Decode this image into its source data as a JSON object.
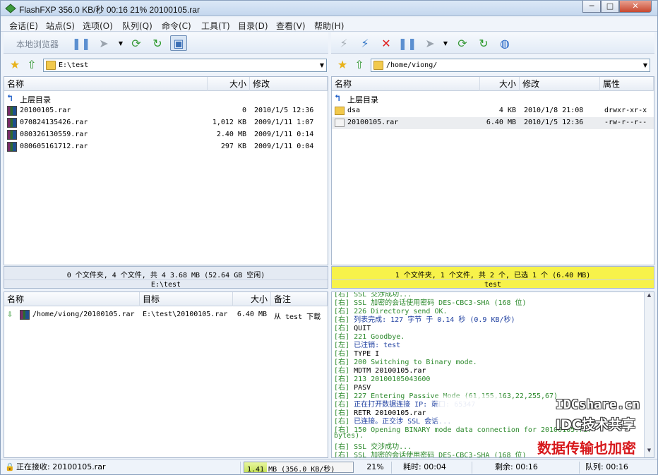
{
  "titlebar": {
    "title": "FlashFXP 356.0 KB/秒 00:16 21% 20100105.rar",
    "min": "─",
    "max": "□",
    "close": "✕"
  },
  "menu": [
    "会话(E)",
    "站点(S)",
    "选项(O)",
    "队列(Q)",
    "命令(C)",
    "工具(T)",
    "目录(D)",
    "查看(V)",
    "帮助(H)"
  ],
  "left_toolbar": {
    "browser_label": "本地浏览器"
  },
  "left_path": "E:\\test",
  "right_path": "/home/viong/",
  "left_columns": {
    "name": "名称",
    "size": "大小",
    "modified": "修改"
  },
  "right_columns": {
    "name": "名称",
    "size": "大小",
    "modified": "修改",
    "attr": "属性"
  },
  "left_files": [
    {
      "name": "上层目录",
      "size": "",
      "modified": "",
      "type": "up"
    },
    {
      "name": "20100105.rar",
      "size": "0",
      "modified": "2010/1/5 12:36",
      "type": "rar"
    },
    {
      "name": "070824135426.rar",
      "size": "1,012 KB",
      "modified": "2009/1/11 1:07",
      "type": "rar"
    },
    {
      "name": "080326130559.rar",
      "size": "2.40 MB",
      "modified": "2009/1/11 0:14",
      "type": "rar"
    },
    {
      "name": "080605161712.rar",
      "size": "297 KB",
      "modified": "2009/1/11 0:04",
      "type": "rar"
    }
  ],
  "right_files": [
    {
      "name": "上层目录",
      "size": "",
      "modified": "",
      "attr": "",
      "type": "up"
    },
    {
      "name": "dsa",
      "size": "4 KB",
      "modified": "2010/1/8 21:08",
      "attr": "drwxr-xr-x",
      "type": "folder"
    },
    {
      "name": "20100105.rar",
      "size": "6.40 MB",
      "modified": "2010/1/5 12:36",
      "attr": "-rw-r--r--",
      "type": "file"
    }
  ],
  "left_status": {
    "summary": "0 个文件夹, 4 个文件, 共 4 3.68 MB (52.64 GB 空闲)",
    "path": "E:\\test"
  },
  "right_status": {
    "summary": "1 个文件夹, 1 个文件, 共 2 个, 已选 1 个 (6.40 MB)",
    "path": "test"
  },
  "queue_columns": {
    "name": "名称",
    "target": "目标",
    "size": "大小",
    "note": "备注"
  },
  "queue": [
    {
      "name": "/home/viong/20100105.rar",
      "target": "E:\\test\\20100105.rar",
      "size": "6.40 MB",
      "note": "从 test 下载"
    }
  ],
  "log": [
    {
      "tag": "[右]",
      "text": "SSL 交涉成功...",
      "color": "#2d8a2d"
    },
    {
      "tag": "[右]",
      "text": "SSL 加密的会话使用密码 DES-CBC3-SHA (168 位)",
      "color": "#2d8a2d"
    },
    {
      "tag": "[右]",
      "text": "226 Directory send OK.",
      "color": "#2d8a2d"
    },
    {
      "tag": "[右]",
      "text": "列表完成: 127 字节 于 0.14 秒 (0.9 KB/秒)",
      "color": "#1e3fa0"
    },
    {
      "tag": "[右]",
      "text": "QUIT",
      "color": "#000000"
    },
    {
      "tag": "[右]",
      "text": "221 Goodbye.",
      "color": "#2d8a2d"
    },
    {
      "tag": "[左]",
      "text": "已注销: test",
      "color": "#1e3fa0"
    },
    {
      "tag": "[右]",
      "text": "TYPE I",
      "color": "#000000"
    },
    {
      "tag": "[右]",
      "text": "200 Switching to Binary mode.",
      "color": "#2d8a2d"
    },
    {
      "tag": "[右]",
      "text": "MDTM 20100105.rar",
      "color": "#000000"
    },
    {
      "tag": "[右]",
      "text": "213 20100105043600",
      "color": "#2d8a2d"
    },
    {
      "tag": "[右]",
      "text": "PASV",
      "color": "#000000"
    },
    {
      "tag": "[右]",
      "text": "227 Entering Passive Mode (61,155,163,22,255,67)",
      "color": "#2d8a2d"
    },
    {
      "tag": "[右]",
      "text": "正在打开数据连接 IP: 端口: 65347",
      "color": "#1e3fa0"
    },
    {
      "tag": "[右]",
      "text": "RETR 20100105.rar",
      "color": "#000000"
    },
    {
      "tag": "[右]",
      "text": "已连接。正交涉 SSL 会话...",
      "color": "#1e3fa0"
    },
    {
      "tag": "[右]",
      "text": "150 Opening BINARY mode data connection for 20100105.rar",
      "color": "#2d8a2d"
    },
    {
      "tag": "",
      "text": "bytes).",
      "color": "#2d8a2d"
    },
    {
      "tag": "[右]",
      "text": "SSL 交涉成功...",
      "color": "#2d8a2d"
    },
    {
      "tag": "[右]",
      "text": "SSL 加密的会话使用密码 DES-CBC3-SHA (168 位)",
      "color": "#2d8a2d"
    }
  ],
  "watermark": {
    "line1": "IDCshare.cn",
    "line2": "IDC技术共享",
    "line3": "数据传输也加密"
  },
  "statusbar": {
    "receiving": "正在接收: 20100105.rar",
    "progress_text": "1.41 MB (356.0 KB/秒)",
    "progress_fraction": 0.21,
    "percent": "21%",
    "elapsed": "耗时: 00:04",
    "remaining": "剩余: 00:16",
    "queue": "队列: 00:16"
  }
}
